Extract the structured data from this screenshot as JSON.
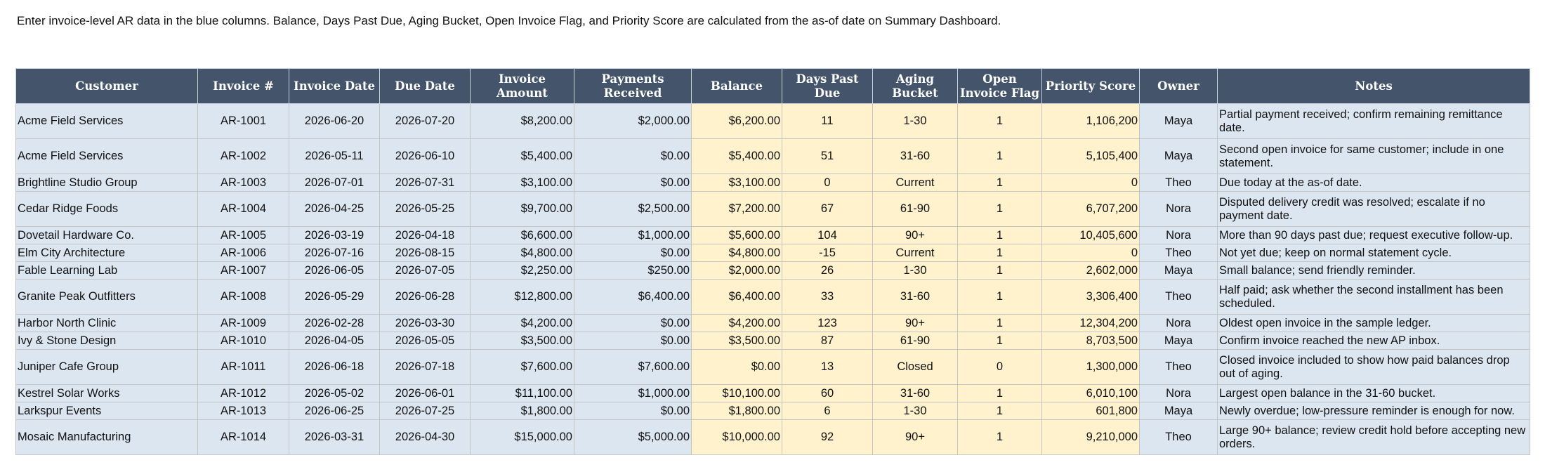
{
  "instructions": "Enter invoice-level AR data in the blue columns. Balance, Days Past Due, Aging Bucket, Open Invoice Flag, and Priority Score are calculated from the as-of date on Summary Dashboard.",
  "columns": [
    {
      "key": "customer",
      "label": "Customer"
    },
    {
      "key": "invoice",
      "label": "Invoice #"
    },
    {
      "key": "invoice_date",
      "label": "Invoice Date"
    },
    {
      "key": "due_date",
      "label": "Due Date"
    },
    {
      "key": "amount",
      "label": "Invoice Amount"
    },
    {
      "key": "payments",
      "label": "Payments Received"
    },
    {
      "key": "balance",
      "label": "Balance"
    },
    {
      "key": "days_past_due",
      "label": "Days Past Due"
    },
    {
      "key": "aging_bucket",
      "label": "Aging Bucket"
    },
    {
      "key": "open_flag",
      "label": "Open Invoice Flag"
    },
    {
      "key": "priority",
      "label": "Priority Score"
    },
    {
      "key": "owner",
      "label": "Owner"
    },
    {
      "key": "notes",
      "label": "Notes"
    }
  ],
  "colors": {
    "header_bg": "#44546a",
    "input_fill": "#dce6f1",
    "calc_fill": "#fff2cc"
  },
  "rows": [
    {
      "customer": "Acme Field Services",
      "invoice": "AR-1001",
      "invoice_date": "2026-06-20",
      "due_date": "2026-07-20",
      "amount": "$8,200.00",
      "payments": "$2,000.00",
      "balance": "$6,200.00",
      "days_past_due": "11",
      "aging_bucket": "1-30",
      "open_flag": "1",
      "priority": "1,106,200",
      "owner": "Maya",
      "notes": "Partial payment received; confirm remaining remittance date."
    },
    {
      "customer": "Acme Field Services",
      "invoice": "AR-1002",
      "invoice_date": "2026-05-11",
      "due_date": "2026-06-10",
      "amount": "$5,400.00",
      "payments": "$0.00",
      "balance": "$5,400.00",
      "days_past_due": "51",
      "aging_bucket": "31-60",
      "open_flag": "1",
      "priority": "5,105,400",
      "owner": "Maya",
      "notes": "Second open invoice for same customer; include in one statement."
    },
    {
      "customer": "Brightline Studio Group",
      "invoice": "AR-1003",
      "invoice_date": "2026-07-01",
      "due_date": "2026-07-31",
      "amount": "$3,100.00",
      "payments": "$0.00",
      "balance": "$3,100.00",
      "days_past_due": "0",
      "aging_bucket": "Current",
      "open_flag": "1",
      "priority": "0",
      "owner": "Theo",
      "notes": "Due today at the as-of date."
    },
    {
      "customer": "Cedar Ridge Foods",
      "invoice": "AR-1004",
      "invoice_date": "2026-04-25",
      "due_date": "2026-05-25",
      "amount": "$9,700.00",
      "payments": "$2,500.00",
      "balance": "$7,200.00",
      "days_past_due": "67",
      "aging_bucket": "61-90",
      "open_flag": "1",
      "priority": "6,707,200",
      "owner": "Nora",
      "notes": "Disputed delivery credit was resolved; escalate if no payment date."
    },
    {
      "customer": "Dovetail Hardware Co.",
      "invoice": "AR-1005",
      "invoice_date": "2026-03-19",
      "due_date": "2026-04-18",
      "amount": "$6,600.00",
      "payments": "$1,000.00",
      "balance": "$5,600.00",
      "days_past_due": "104",
      "aging_bucket": "90+",
      "open_flag": "1",
      "priority": "10,405,600",
      "owner": "Nora",
      "notes": "More than 90 days past due; request executive follow-up."
    },
    {
      "customer": "Elm City Architecture",
      "invoice": "AR-1006",
      "invoice_date": "2026-07-16",
      "due_date": "2026-08-15",
      "amount": "$4,800.00",
      "payments": "$0.00",
      "balance": "$4,800.00",
      "days_past_due": "-15",
      "aging_bucket": "Current",
      "open_flag": "1",
      "priority": "0",
      "owner": "Theo",
      "notes": "Not yet due; keep on normal statement cycle."
    },
    {
      "customer": "Fable Learning Lab",
      "invoice": "AR-1007",
      "invoice_date": "2026-06-05",
      "due_date": "2026-07-05",
      "amount": "$2,250.00",
      "payments": "$250.00",
      "balance": "$2,000.00",
      "days_past_due": "26",
      "aging_bucket": "1-30",
      "open_flag": "1",
      "priority": "2,602,000",
      "owner": "Maya",
      "notes": "Small balance; send friendly reminder."
    },
    {
      "customer": "Granite Peak Outfitters",
      "invoice": "AR-1008",
      "invoice_date": "2026-05-29",
      "due_date": "2026-06-28",
      "amount": "$12,800.00",
      "payments": "$6,400.00",
      "balance": "$6,400.00",
      "days_past_due": "33",
      "aging_bucket": "31-60",
      "open_flag": "1",
      "priority": "3,306,400",
      "owner": "Theo",
      "notes": "Half paid; ask whether the second installment has been scheduled."
    },
    {
      "customer": "Harbor North Clinic",
      "invoice": "AR-1009",
      "invoice_date": "2026-02-28",
      "due_date": "2026-03-30",
      "amount": "$4,200.00",
      "payments": "$0.00",
      "balance": "$4,200.00",
      "days_past_due": "123",
      "aging_bucket": "90+",
      "open_flag": "1",
      "priority": "12,304,200",
      "owner": "Nora",
      "notes": "Oldest open invoice in the sample ledger."
    },
    {
      "customer": "Ivy & Stone Design",
      "invoice": "AR-1010",
      "invoice_date": "2026-04-05",
      "due_date": "2026-05-05",
      "amount": "$3,500.00",
      "payments": "$0.00",
      "balance": "$3,500.00",
      "days_past_due": "87",
      "aging_bucket": "61-90",
      "open_flag": "1",
      "priority": "8,703,500",
      "owner": "Maya",
      "notes": "Confirm invoice reached the new AP inbox."
    },
    {
      "customer": "Juniper Cafe Group",
      "invoice": "AR-1011",
      "invoice_date": "2026-06-18",
      "due_date": "2026-07-18",
      "amount": "$7,600.00",
      "payments": "$7,600.00",
      "balance": "$0.00",
      "days_past_due": "13",
      "aging_bucket": "Closed",
      "open_flag": "0",
      "priority": "1,300,000",
      "owner": "Theo",
      "notes": "Closed invoice included to show how paid balances drop out of aging."
    },
    {
      "customer": "Kestrel Solar Works",
      "invoice": "AR-1012",
      "invoice_date": "2026-05-02",
      "due_date": "2026-06-01",
      "amount": "$11,100.00",
      "payments": "$1,000.00",
      "balance": "$10,100.00",
      "days_past_due": "60",
      "aging_bucket": "31-60",
      "open_flag": "1",
      "priority": "6,010,100",
      "owner": "Nora",
      "notes": "Largest open balance in the 31-60 bucket."
    },
    {
      "customer": "Larkspur Events",
      "invoice": "AR-1013",
      "invoice_date": "2026-06-25",
      "due_date": "2026-07-25",
      "amount": "$1,800.00",
      "payments": "$0.00",
      "balance": "$1,800.00",
      "days_past_due": "6",
      "aging_bucket": "1-30",
      "open_flag": "1",
      "priority": "601,800",
      "owner": "Maya",
      "notes": "Newly overdue; low-pressure reminder is enough for now."
    },
    {
      "customer": "Mosaic Manufacturing",
      "invoice": "AR-1014",
      "invoice_date": "2026-03-31",
      "due_date": "2026-04-30",
      "amount": "$15,000.00",
      "payments": "$5,000.00",
      "balance": "$10,000.00",
      "days_past_due": "92",
      "aging_bucket": "90+",
      "open_flag": "1",
      "priority": "9,210,000",
      "owner": "Theo",
      "notes": "Large 90+ balance; review credit hold before accepting new orders."
    }
  ]
}
